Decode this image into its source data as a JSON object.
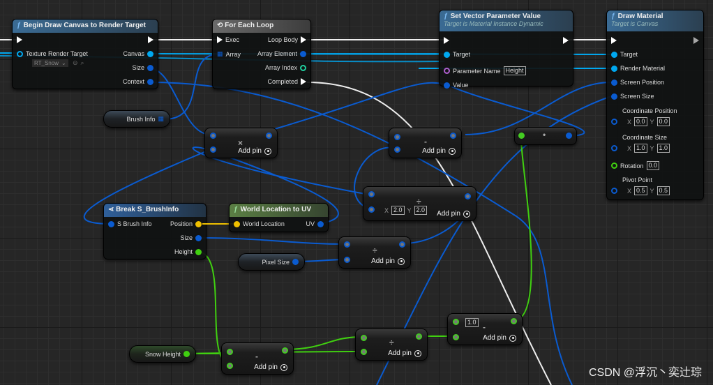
{
  "colors": {
    "exec": "#ffffff",
    "object": "#00a8f0",
    "struct": "#0a5bd0",
    "vector": "#f0c000",
    "float": "#40d010",
    "name": "#b060d0",
    "int": "#20d0a0",
    "background": "#262626"
  },
  "begin_draw": {
    "title": "Begin Draw Canvas to Render Target",
    "icon": "function-icon",
    "texture_label": "Texture Render Target",
    "texture_value": "RT_Snow",
    "canvas": "Canvas",
    "size": "Size",
    "context": "Context"
  },
  "for_each": {
    "title": "For Each Loop",
    "icon": "loop-icon",
    "exec": "Exec",
    "array": "Array",
    "loop_body": "Loop Body",
    "array_element": "Array Element",
    "array_index": "Array Index",
    "completed": "Completed"
  },
  "set_vector": {
    "title": "Set Vector Parameter Value",
    "subtitle": "Target is Material Instance Dynamic",
    "target": "Target",
    "param_name": "Parameter Name",
    "param_value": "Height",
    "value": "Value"
  },
  "draw_material": {
    "title": "Draw Material",
    "subtitle": "Target is Canvas",
    "target": "Target",
    "render_material": "Render Material",
    "screen_position": "Screen Position",
    "screen_size": "Screen Size",
    "coord_pos": "Coordinate Position",
    "coord_pos_x": "0.0",
    "coord_pos_y": "0.0",
    "coord_size": "Coordinate Size",
    "coord_size_x": "1.0",
    "coord_size_y": "1.0",
    "rotation": "Rotation",
    "rotation_value": "0.0",
    "pivot": "Pivot Point",
    "pivot_x": "0.5",
    "pivot_y": "0.5",
    "x": "X",
    "y": "Y"
  },
  "break_brush": {
    "title": "Break S_BrushInfo",
    "input": "S Brush Info",
    "position": "Position",
    "size": "Size",
    "height": "Height"
  },
  "world_to_uv": {
    "title": "World Location to UV",
    "input": "World Location",
    "output": "UV"
  },
  "vars": {
    "brush_info": "Brush Info",
    "pixel_size": "Pixel Size",
    "snow_height": "Snow Height"
  },
  "math": {
    "add_pin": "Add pin",
    "multiply": "×",
    "subtract": "-",
    "divide": "÷",
    "dot": "•",
    "divide_x": "2.0",
    "divide_y": "2.0",
    "x": "X",
    "y": "Y",
    "subtract_const": "1.0"
  },
  "watermark": "CSDN @浮沉丶奕辻琮"
}
